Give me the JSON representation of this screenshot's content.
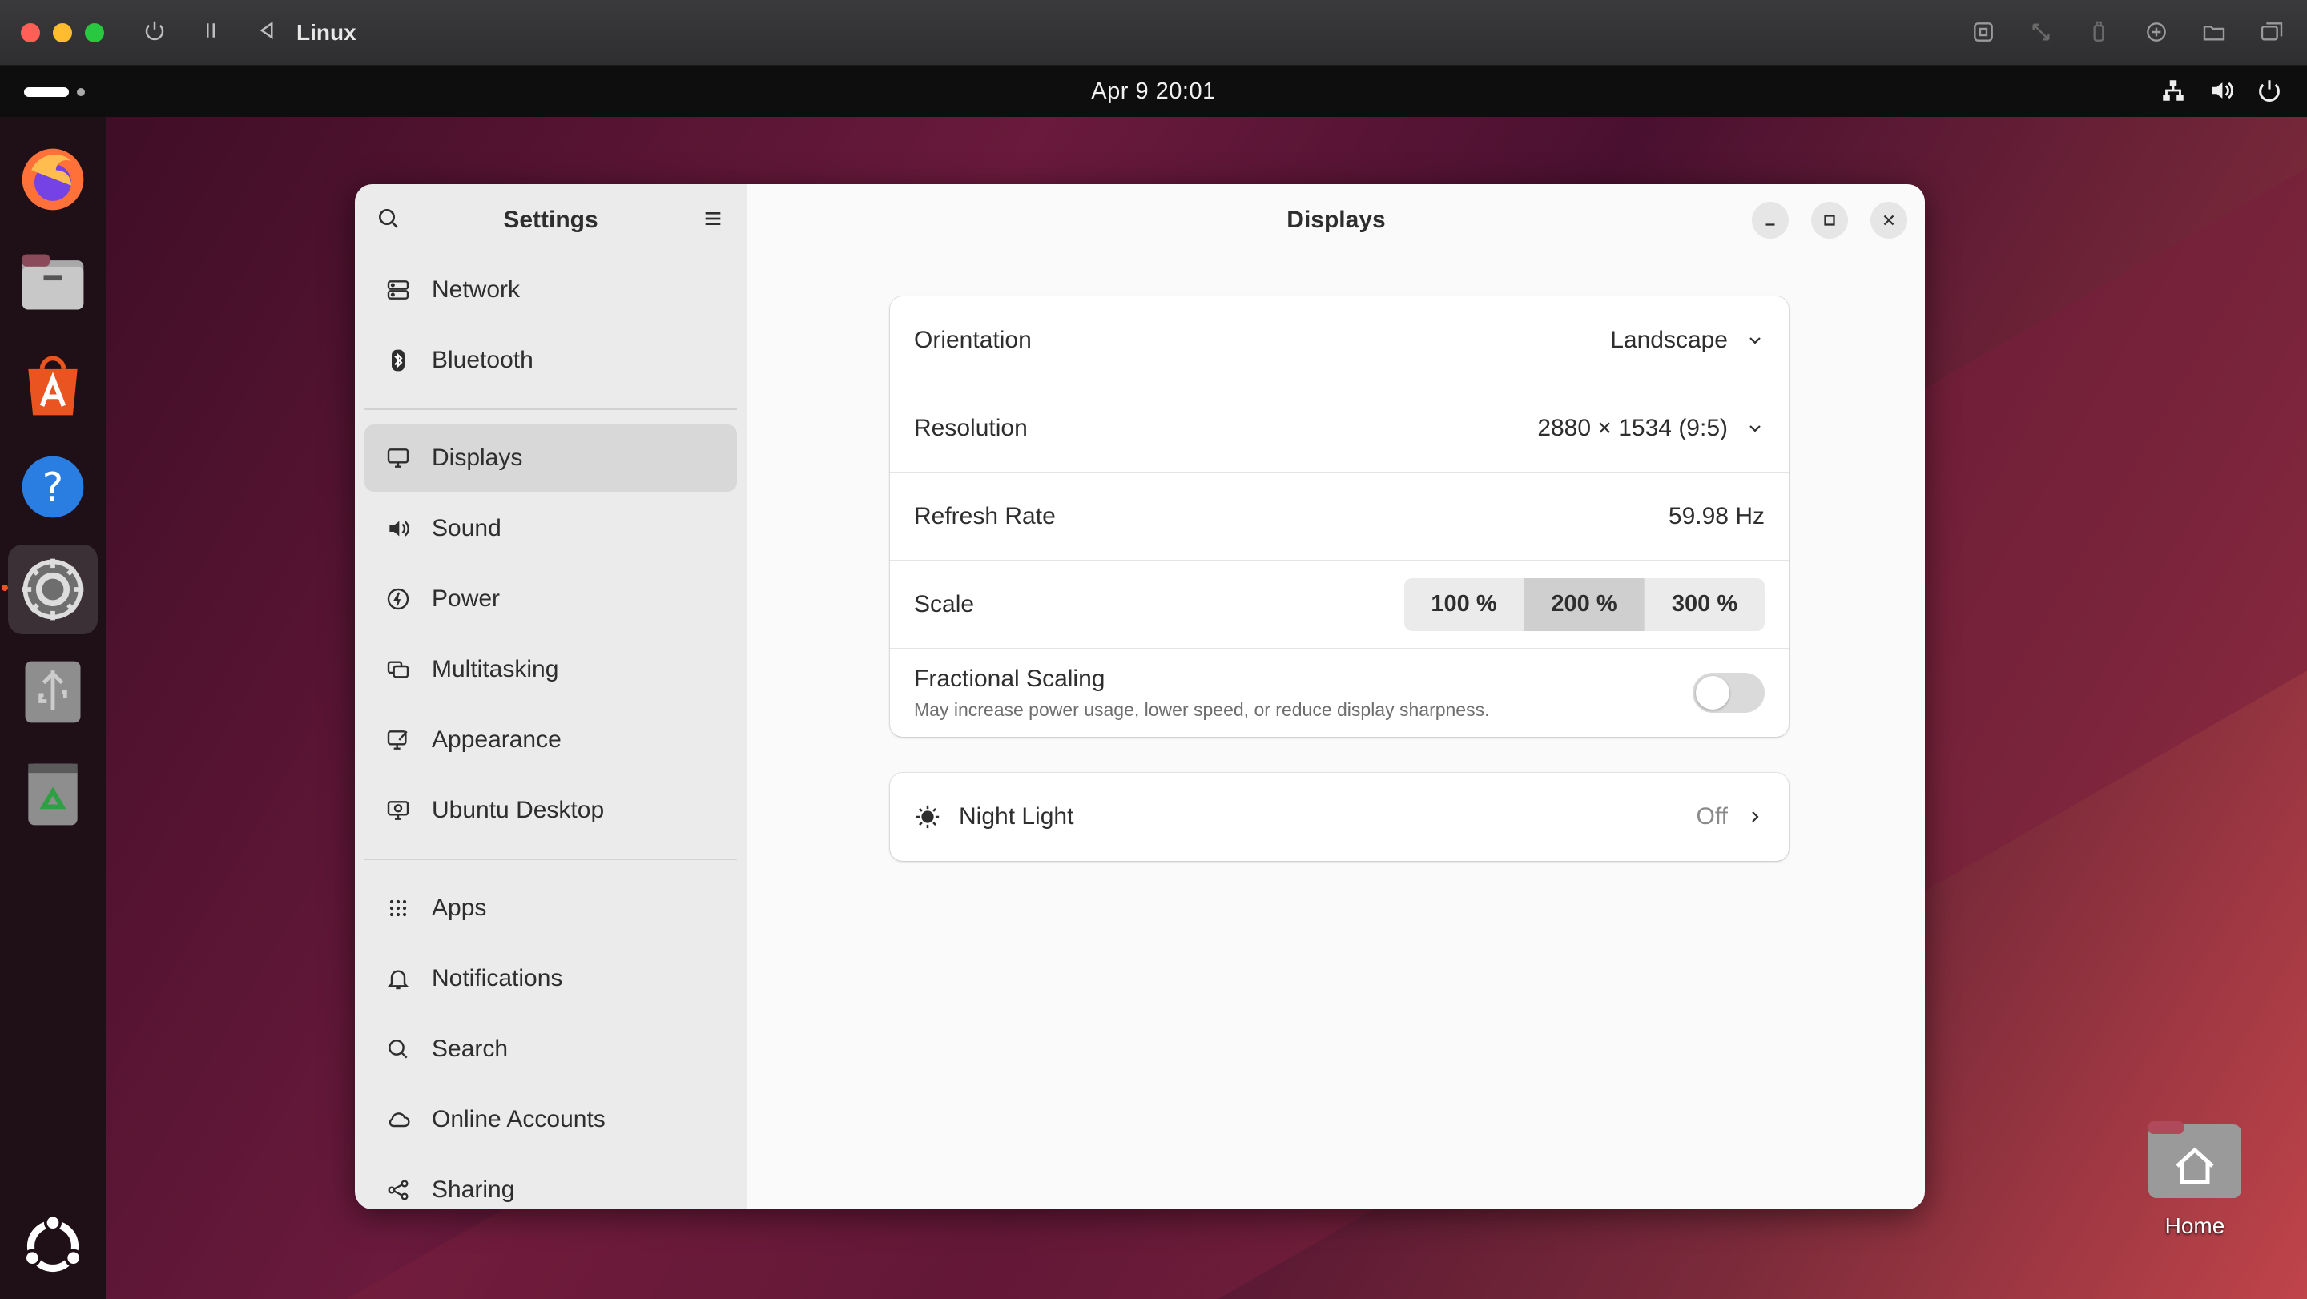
{
  "vm": {
    "title": "Linux"
  },
  "topbar": {
    "clock": "Apr 9  20:01"
  },
  "desktop": {
    "home_label": "Home"
  },
  "settings": {
    "sidebar_title": "Settings",
    "groups": [
      [
        {
          "label": "Network",
          "icon": "network-icon"
        },
        {
          "label": "Bluetooth",
          "icon": "bluetooth-icon"
        }
      ],
      [
        {
          "label": "Displays",
          "icon": "display-icon",
          "selected": true
        },
        {
          "label": "Sound",
          "icon": "sound-icon"
        },
        {
          "label": "Power",
          "icon": "power-icon"
        },
        {
          "label": "Multitasking",
          "icon": "multitasking-icon"
        },
        {
          "label": "Appearance",
          "icon": "appearance-icon"
        },
        {
          "label": "Ubuntu Desktop",
          "icon": "ubuntu-desktop-icon"
        }
      ],
      [
        {
          "label": "Apps",
          "icon": "apps-icon"
        },
        {
          "label": "Notifications",
          "icon": "bell-icon"
        },
        {
          "label": "Search",
          "icon": "search-icon"
        },
        {
          "label": "Online Accounts",
          "icon": "cloud-icon"
        },
        {
          "label": "Sharing",
          "icon": "share-icon"
        }
      ]
    ]
  },
  "displays": {
    "title": "Displays",
    "orientation": {
      "label": "Orientation",
      "value": "Landscape"
    },
    "resolution": {
      "label": "Resolution",
      "value": "2880 × 1534 (9:5)"
    },
    "refresh": {
      "label": "Refresh Rate",
      "value": "59.98 Hz"
    },
    "scale": {
      "label": "Scale",
      "options": [
        "100 %",
        "200 %",
        "300 %"
      ],
      "selected": "200 %"
    },
    "fractional": {
      "label": "Fractional Scaling",
      "description": "May increase power usage, lower speed, or reduce display sharpness.",
      "enabled": false
    },
    "night_light": {
      "label": "Night Light",
      "value": "Off"
    }
  },
  "colors": {
    "accent": "#e95420",
    "window_bg": "#fafafa",
    "sidebar_bg": "#ebebeb"
  }
}
